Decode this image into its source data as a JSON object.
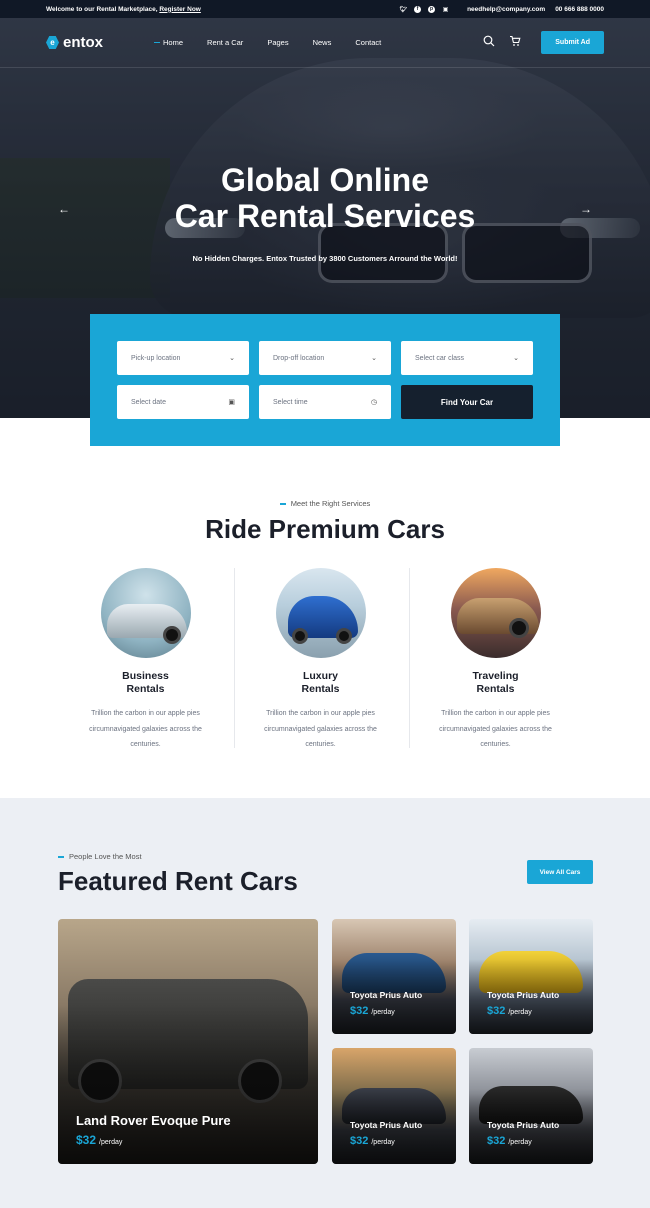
{
  "topbar": {
    "welcome": "Welcome to our Rental Marketplace,",
    "register": "Register Now",
    "email": "needhelp@company.com",
    "phone": "00 666 888 0000",
    "socials": [
      "twitter-icon",
      "facebook-icon",
      "pinterest-icon",
      "instagram-icon"
    ]
  },
  "nav": {
    "brand": "entox",
    "items": [
      "Home",
      "Rent a Car",
      "Pages",
      "News",
      "Contact"
    ],
    "active": "Home",
    "submit": "Submit Ad"
  },
  "hero": {
    "title_line1": "Global Online",
    "title_line2": "Car Rental Services",
    "subtitle": "No Hidden Charges. Entox Trusted by 3800 Customers Arround the World!"
  },
  "search": {
    "pickup": "Pick-up location",
    "dropoff": "Drop-off location",
    "carclass": "Select car class",
    "date": "Select date",
    "time": "Select time",
    "button": "Find Your Car"
  },
  "services": {
    "tag": "Meet the Right Services",
    "title": "Ride Premium Cars",
    "items": [
      {
        "line1": "Business",
        "line2": "Rentals",
        "desc": "Trillion the carbon in our apple pies circumnavigated galaxies across the centuries."
      },
      {
        "line1": "Luxury",
        "line2": "Rentals",
        "desc": "Trillion the carbon in our apple pies circumnavigated galaxies across the centuries."
      },
      {
        "line1": "Traveling",
        "line2": "Rentals",
        "desc": "Trillion the carbon in our apple pies circumnavigated galaxies across the centuries."
      }
    ]
  },
  "featured": {
    "tag": "People Love the Most",
    "title": "Featured Rent Cars",
    "view_all": "View All Cars",
    "big": {
      "title": "Land Rover Evoque Pure",
      "price": "$32",
      "unit": "/perday"
    },
    "cards": [
      {
        "title": "Toyota Prius Auto",
        "price": "$32",
        "unit": "/perday"
      },
      {
        "title": "Toyota Prius Auto",
        "price": "$32",
        "unit": "/perday"
      },
      {
        "title": "Toyota Prius Auto",
        "price": "$32",
        "unit": "/perday"
      },
      {
        "title": "Toyota Prius Auto",
        "price": "$32",
        "unit": "/perday"
      }
    ]
  },
  "colors": {
    "accent": "#1aa6d6",
    "dark": "#15202e",
    "section_bg": "#eceff4"
  }
}
